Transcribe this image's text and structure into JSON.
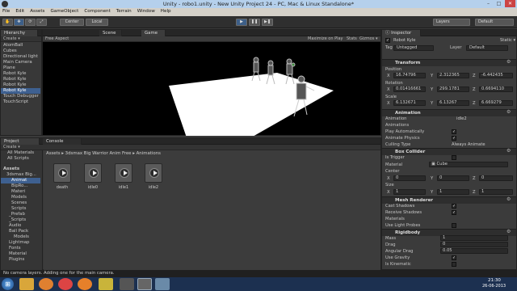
{
  "window": {
    "title": "Unity - robo1.unity - New Unity Project 24 - PC, Mac & Linux Standalone*",
    "min": "–",
    "max": "□",
    "close": "✕"
  },
  "menu": [
    "File",
    "Edit",
    "Assets",
    "GameObject",
    "Component",
    "Terrain",
    "Window",
    "Help"
  ],
  "toolbar": {
    "hand": "✋",
    "move": "✥",
    "rotate": "⟳",
    "scale": "⤢",
    "center": "Center",
    "local": "Local",
    "play": "▶",
    "pause": "❚❚",
    "step": "▶❚",
    "layers": "Layers",
    "layout": "Default"
  },
  "hierarchy": {
    "tab": "Hierarchy",
    "create": "Create ▾",
    "search": "All",
    "items": [
      "AtomBall",
      "Cubes",
      "Directional light",
      "Main Camera",
      "Plane",
      "Robot Kyle",
      "Robot Kyle",
      "Robot Kyle",
      "Robot Kyle",
      "Touch Debugger",
      "TouchScript"
    ],
    "selected_index": 8
  },
  "scene": {
    "tab": "Scene",
    "free_aspect": "Free Aspect"
  },
  "game": {
    "tab": "Game",
    "maximize": "Maximize on Play",
    "stats": "Stats",
    "gizmos": "Gizmos ▾"
  },
  "inspector": {
    "tab": "Inspector",
    "static": "Static ▾",
    "name": "Robot Kyle",
    "tag_label": "Tag",
    "tag": "Untagged",
    "layer_label": "Layer",
    "layer": "Default",
    "transform": {
      "title": "Transform",
      "position_label": "Position",
      "pos": [
        "16.74796",
        "2.312365",
        "-6.442435"
      ],
      "rotation_label": "Rotation",
      "rot": [
        "0.01416661",
        "299.1781",
        "0.6694110"
      ],
      "scale_label": "Scale",
      "scale": [
        "6.132671",
        "6.13267",
        "6.669279"
      ]
    },
    "animation": {
      "title": "Animation",
      "fields": [
        {
          "label": "Animation",
          "value": "idle2"
        },
        {
          "label": "Animations",
          "value": ""
        },
        {
          "label": "Play Automatically",
          "value": "✓"
        },
        {
          "label": "Animate Physics",
          "value": "✓"
        },
        {
          "label": "Culling Type",
          "value": "Always Animate"
        }
      ]
    },
    "box_collider": {
      "title": "Box Collider",
      "is_trigger": "Is Trigger",
      "material_label": "Material",
      "material": "▣ Cube",
      "center_label": "Center",
      "center": [
        "0",
        "0",
        "0"
      ],
      "size_label": "Size",
      "size": [
        "1",
        "1",
        "1"
      ]
    },
    "mesh_renderer": {
      "title": "Mesh Renderer",
      "fields": [
        {
          "label": "Cast Shadows",
          "value": "✓"
        },
        {
          "label": "Receive Shadows",
          "value": "✓"
        },
        {
          "label": "Materials",
          "value": ""
        },
        {
          "label": "Use Light Probes",
          "value": ""
        }
      ]
    },
    "rigidbody": {
      "title": "Rigidbody",
      "fields": [
        {
          "label": "Mass",
          "value": "1"
        },
        {
          "label": "Drag",
          "value": "0"
        },
        {
          "label": "Angular Drag",
          "value": "0.05"
        },
        {
          "label": "Use Gravity",
          "value": "✓"
        },
        {
          "label": "Is Kinematic",
          "value": ""
        }
      ]
    },
    "axes": [
      "X",
      "Y",
      "Z"
    ]
  },
  "project": {
    "tab": "Project",
    "create": "Create ▾",
    "console_tab": "Console",
    "favs": [
      "All Materials",
      "All Scripts"
    ],
    "tree": [
      "Assets",
      "3dsmax Big...",
      "Animat",
      "BipRo...",
      "Materi",
      "Models",
      "Scenes",
      "Scripts",
      "_Prefab",
      "_Scripts",
      "Audio",
      "Ball Pack",
      "Models",
      "Lightmap",
      "Fonts",
      "Material",
      "Plugins"
    ],
    "breadcrumb": "Assets ▸ 3dsmax Big Warrior Anim Free ▸ Animations",
    "assets": [
      "death",
      "idle0",
      "idle1",
      "idle2"
    ]
  },
  "status": "No camera layers. Adding one for the main camera.",
  "taskbar": {
    "start": "⊞",
    "time": "21:30",
    "date": "26-06-2013"
  },
  "colors": {
    "selection": "#3e6090",
    "game_bg": "#000000",
    "plane": "#ffffff",
    "taskbar": "#1c3050"
  }
}
